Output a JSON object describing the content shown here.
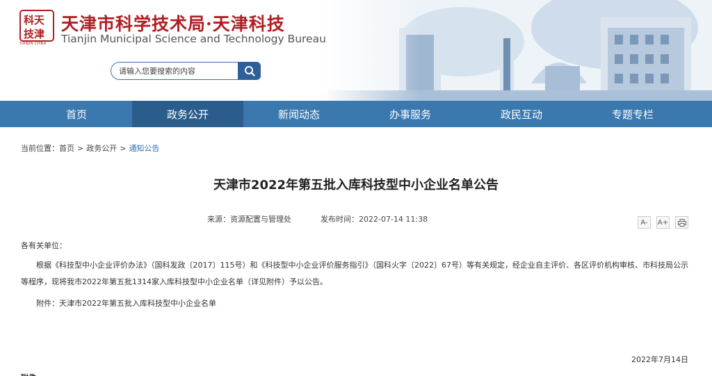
{
  "header": {
    "seal_text": "TIANJIN CHINA",
    "title_cn": "天津市科学技术局·天津科技",
    "title_en": "Tianjin Municipal Science and Technology Bureau"
  },
  "search": {
    "placeholder": "请输入您要搜索的内容",
    "icon": "search-icon"
  },
  "nav": {
    "items": [
      {
        "label": "首页",
        "active": false
      },
      {
        "label": "政务公开",
        "active": true
      },
      {
        "label": "新闻动态",
        "active": false
      },
      {
        "label": "办事服务",
        "active": false
      },
      {
        "label": "政民互动",
        "active": false
      },
      {
        "label": "专题专栏",
        "active": false
      }
    ]
  },
  "breadcrumb": {
    "prefix": "当前位置：",
    "items": [
      "首页",
      "政务公开",
      "通知公告"
    ],
    "separator": ">"
  },
  "article": {
    "title": "天津市2022年第五批入库科技型中小企业名单公告",
    "source": "来源：资源配置与管理处",
    "published": "发布时间：2022-07-14 11:38",
    "salutation": "各有关单位：",
    "paragraph": "根据《科技型中小企业评价办法》（国科发政〔2017〕115号）和《科技型中小企业评价服务指引》（国科火字〔2022〕67号）等有关规定，经企业自主评价、各区评价机构审核、市科技局公示等程序，现将我市2022年第五批1314家入库科技型中小企业名单（详见附件）予以公告。",
    "attachment": "附件：天津市2022年第五批入库科技型中小企业名单",
    "date": "2022年7月14日",
    "cut_text": "附件"
  },
  "tools": {
    "font_decrease": "A-",
    "font_increase": "A+",
    "print_icon": "print-icon"
  },
  "colors": {
    "nav_bg": "#3b78ae",
    "nav_active": "#2b5d8c",
    "brand_red": "#b01e23",
    "link_blue": "#2e6fb0"
  }
}
